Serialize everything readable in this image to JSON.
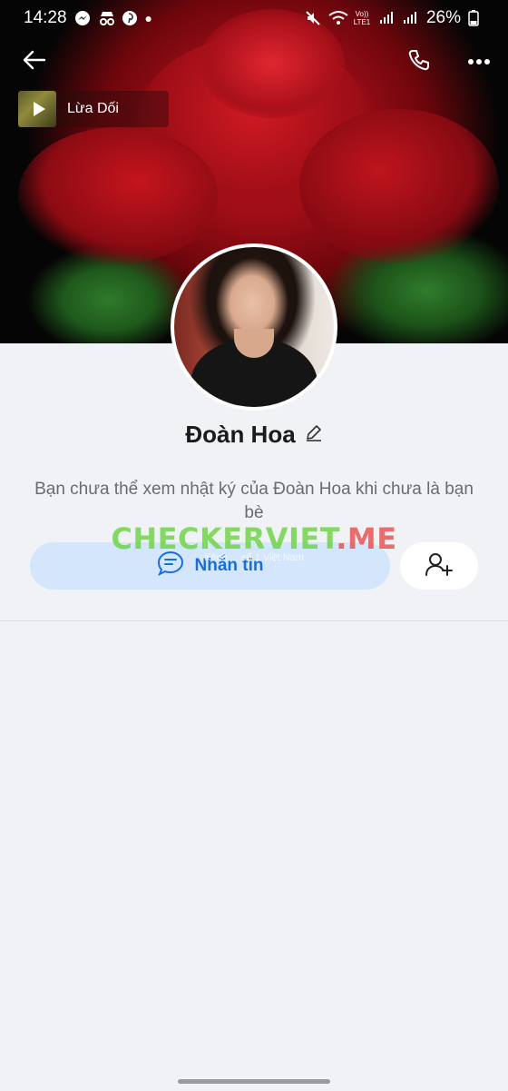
{
  "status_bar": {
    "time": "14:28",
    "network": "Vo)) LTE1",
    "battery": "26%",
    "icons": [
      "messenger-icon",
      "incognito-icon",
      "pinterest-icon",
      "dot-icon",
      "mute-icon",
      "wifi-icon",
      "signal-icon",
      "signal-icon",
      "battery-icon"
    ]
  },
  "header": {
    "back_icon": "arrow-left-icon",
    "call_icon": "phone-icon",
    "more_icon": "more-horizontal-icon"
  },
  "music": {
    "title": "Lừa Dối",
    "icon": "play-icon"
  },
  "profile": {
    "name": "Đoàn Hoa",
    "edit_icon": "pencil-icon",
    "notice": "Bạn chưa thể xem nhật ký của Đoàn Hoa khi chưa là bạn bè"
  },
  "watermark": {
    "text": "CHECKERVIET",
    "suffix": ".ME"
  },
  "actions": {
    "message_label": "Nhắn tin",
    "message_sub": "Kênh ... số 1 Việt Nam",
    "message_icon": "chat-bubble-icon",
    "add_friend_icon": "add-friend-icon"
  },
  "colors": {
    "accent": "#1a6ed8",
    "message_bg": "#d3e6fb",
    "page_bg": "#f1f2f6"
  }
}
